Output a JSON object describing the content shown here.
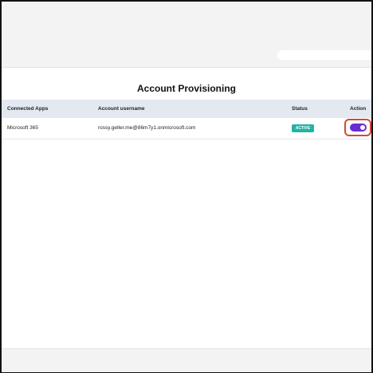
{
  "page": {
    "title": "Account Provisioning"
  },
  "table": {
    "headers": [
      "Connected Apps",
      "Account username",
      "Status",
      "Action"
    ],
    "rows": [
      {
        "app": "Microsoft 365",
        "username": "rossy.geller.me@86m7y1.onmicrosoft.com",
        "status": "ACTIVE",
        "action_toggle": "on"
      }
    ]
  },
  "colors": {
    "accent": "#6b2bd6",
    "status_active": "#22b3a6",
    "focus_outline": "#d24a32",
    "header_bg": "#e4e9f1"
  }
}
